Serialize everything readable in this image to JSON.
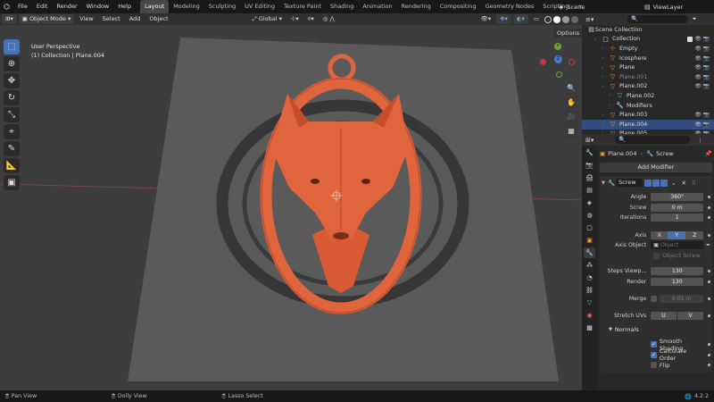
{
  "menu": {
    "items": [
      "File",
      "Edit",
      "Render",
      "Window",
      "Help"
    ],
    "workspaces": [
      "Layout",
      "Modeling",
      "Sculpting",
      "UV Editing",
      "Texture Paint",
      "Shading",
      "Animation",
      "Rendering",
      "Compositing",
      "Geometry Nodes",
      "Scripting"
    ],
    "active_workspace": "Layout",
    "add_tab": "+",
    "scene": "Scene",
    "view_layer": "ViewLayer"
  },
  "header": {
    "mode": "Object Mode",
    "menus": [
      "View",
      "Select",
      "Add",
      "Object"
    ],
    "transform": "Global",
    "options": "Options"
  },
  "viewport": {
    "perspective": "User Perspective",
    "collection_info": "(1) Collection | Plane.004",
    "gizmo": {
      "y": "Y",
      "z": "Z"
    }
  },
  "outliner": {
    "root": "Scene Collection",
    "items": [
      {
        "label": "Collection",
        "indent": 1,
        "icon": "collection",
        "dim": false
      },
      {
        "label": "Empty",
        "indent": 2,
        "icon": "empty",
        "dim": false
      },
      {
        "label": "Icosphere",
        "indent": 2,
        "icon": "mesh",
        "dim": false
      },
      {
        "label": "Plane",
        "indent": 2,
        "icon": "mesh",
        "dim": false
      },
      {
        "label": "Plane.001",
        "indent": 2,
        "icon": "mesh",
        "dim": true
      },
      {
        "label": "Plane.002",
        "indent": 2,
        "icon": "mesh",
        "dim": false
      },
      {
        "label": "Plane.002",
        "indent": 3,
        "icon": "mesh-data",
        "dim": false
      },
      {
        "label": "Modifiers",
        "indent": 3,
        "icon": "wrench",
        "dim": false
      },
      {
        "label": "Plane.003",
        "indent": 2,
        "icon": "mesh",
        "dim": false
      },
      {
        "label": "Plane.004",
        "indent": 2,
        "icon": "mesh",
        "dim": false,
        "selected": true
      },
      {
        "label": "Plane.005",
        "indent": 2,
        "icon": "mesh",
        "dim": false
      }
    ]
  },
  "properties": {
    "object_name": "Plane.004",
    "modifier_tab": "Screw",
    "add_modifier": "Add Modifier",
    "modifier_name": "Screw",
    "fields": [
      {
        "label": "Angle",
        "value": "360°"
      },
      {
        "label": "Screw",
        "value": "0 m"
      },
      {
        "label": "Iterations",
        "value": "1"
      }
    ],
    "axis_label": "Axis",
    "axis_options": [
      "X",
      "Y",
      "Z"
    ],
    "axis_selected": "Y",
    "axis_object_label": "Axis Object",
    "axis_object_placeholder": "Object",
    "object_screw": "Object Screw",
    "steps": [
      {
        "label": "Steps Viewp...",
        "value": "130"
      },
      {
        "label": "Render",
        "value": "130"
      }
    ],
    "merge_label": "Merge",
    "merge_value": "0.01 m",
    "stretch_label": "Stretch UVs",
    "stretch_options": [
      "U",
      "V"
    ],
    "normals_label": "Normals",
    "normals": [
      {
        "label": "Smooth Shading",
        "checked": true
      },
      {
        "label": "Calculate Order",
        "checked": true
      },
      {
        "label": "Flip",
        "checked": false
      }
    ]
  },
  "status": {
    "pan": "Pan View",
    "dolly": "Dolly View",
    "lasso": "Lasso Select",
    "version": "4.2.2"
  },
  "colors": {
    "accent": "#4772b3",
    "pendant": "#e0643c",
    "viewport_bg": "#3d3d3d",
    "plane": "#5a5a5a"
  }
}
